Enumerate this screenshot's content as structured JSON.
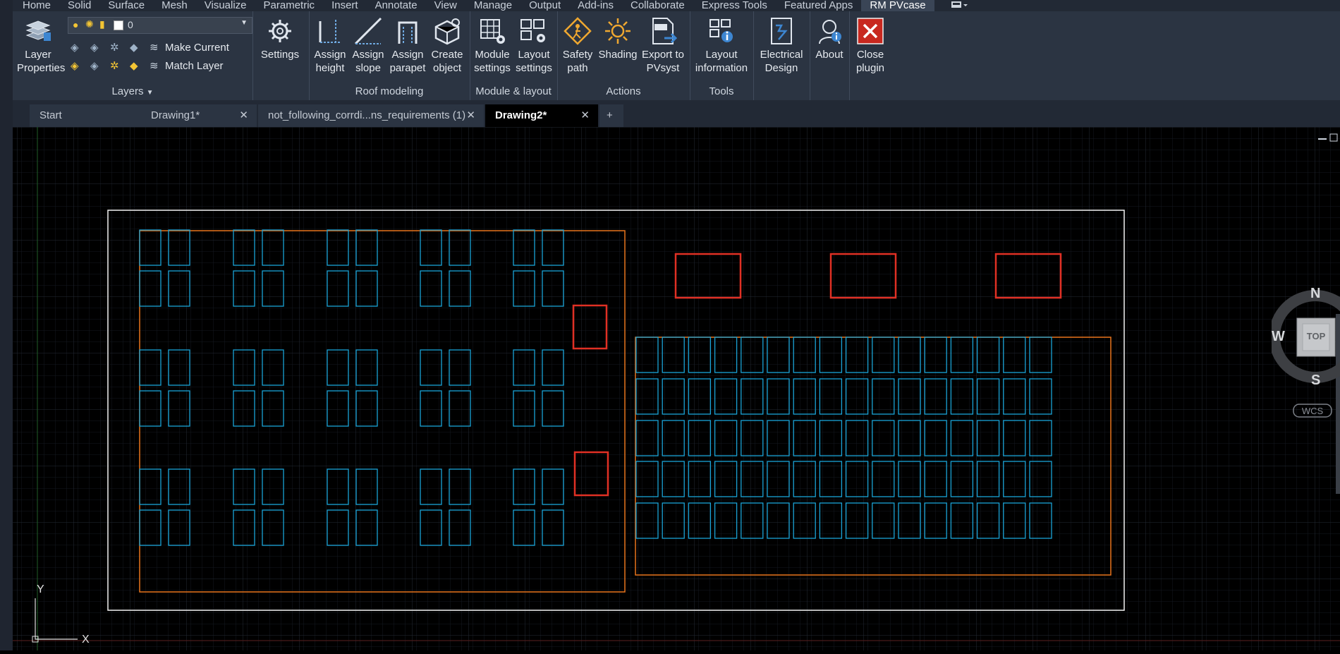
{
  "menu": [
    "Home",
    "Solid",
    "Surface",
    "Mesh",
    "Visualize",
    "Parametric",
    "Insert",
    "Annotate",
    "View",
    "Manage",
    "Output",
    "Add-ins",
    "Collaborate",
    "Express Tools",
    "Featured Apps",
    "RM PVcase"
  ],
  "menu_active": "RM PVcase",
  "ribbon": {
    "layers": {
      "title": "Layers",
      "layer_properties": "Layer Properties",
      "current_layer": "0",
      "make_current": "Make Current",
      "match_layer": "Match Layer"
    },
    "settings": "Settings",
    "roof_modeling": {
      "title": "Roof modeling",
      "buttons": [
        "Assign height",
        "Assign slope",
        "Assign parapet",
        "Create object"
      ]
    },
    "module_layout": {
      "title": "Module & layout",
      "buttons": [
        "Module settings",
        "Layout settings"
      ]
    },
    "actions": {
      "title": "Actions",
      "buttons": [
        "Safety path",
        "Shading",
        "Export to PVsyst"
      ]
    },
    "tools": {
      "title": "Tools",
      "buttons": [
        "Layout information"
      ]
    },
    "electrical": "Electrical Design",
    "about": "About",
    "close": "Close plugin"
  },
  "tabs": [
    {
      "label": "Start",
      "active": false,
      "closable": false
    },
    {
      "label": "Drawing1*",
      "active": false,
      "closable": true
    },
    {
      "label": "not_following_corrdi...ns_requirements (1)",
      "active": false,
      "closable": true
    },
    {
      "label": "Drawing2*",
      "active": true,
      "closable": true
    }
  ],
  "viewcube": {
    "north": "N",
    "south": "S",
    "west": "W",
    "face": "TOP",
    "wcs": "WCS"
  },
  "ucs": {
    "x": "X",
    "y": "Y"
  },
  "colors": {
    "module": "#1aa3d6",
    "boundary": "#e8741c",
    "obstacle": "#e03024",
    "building": "#f2f2f2"
  }
}
